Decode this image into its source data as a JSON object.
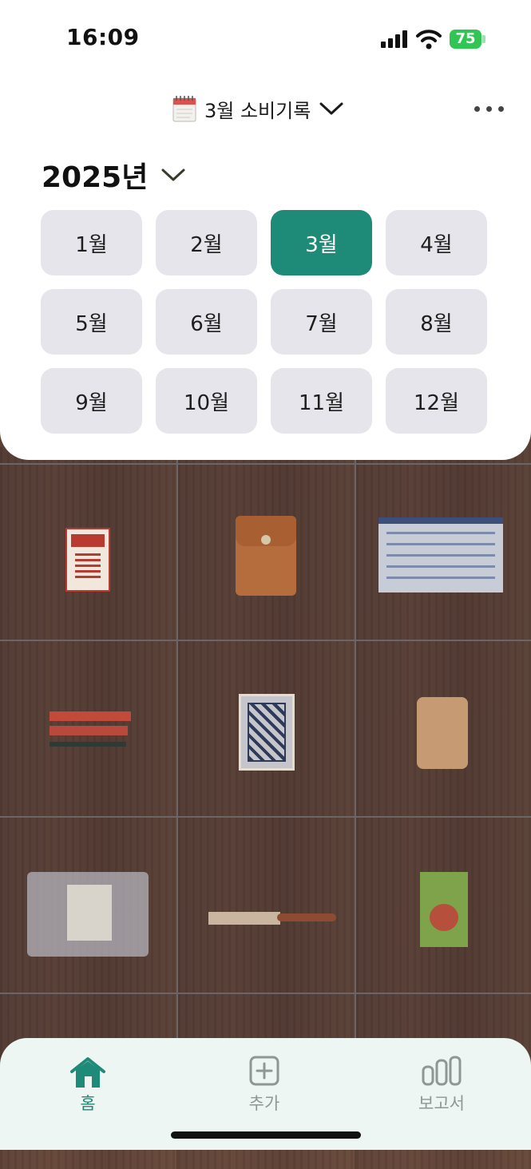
{
  "status_bar": {
    "time": "16:09",
    "battery": "75"
  },
  "header": {
    "title": "3월 소비기록",
    "calendar_icon": "calendar-icon",
    "more_icon": "more-icon"
  },
  "year_picker": {
    "year": "2025년"
  },
  "months": [
    {
      "label": "1월",
      "active": false
    },
    {
      "label": "2월",
      "active": false
    },
    {
      "label": "3월",
      "active": true
    },
    {
      "label": "4월",
      "active": false
    },
    {
      "label": "5월",
      "active": false
    },
    {
      "label": "6월",
      "active": false
    },
    {
      "label": "7월",
      "active": false
    },
    {
      "label": "8월",
      "active": false
    },
    {
      "label": "9월",
      "active": false
    },
    {
      "label": "10월",
      "active": false
    },
    {
      "label": "11월",
      "active": false
    },
    {
      "label": "12월",
      "active": false
    }
  ],
  "tabbar": {
    "home": "홈",
    "add": "추가",
    "report": "보고서",
    "active_color": "#1e8a78",
    "inactive_color": "#8f9695"
  }
}
